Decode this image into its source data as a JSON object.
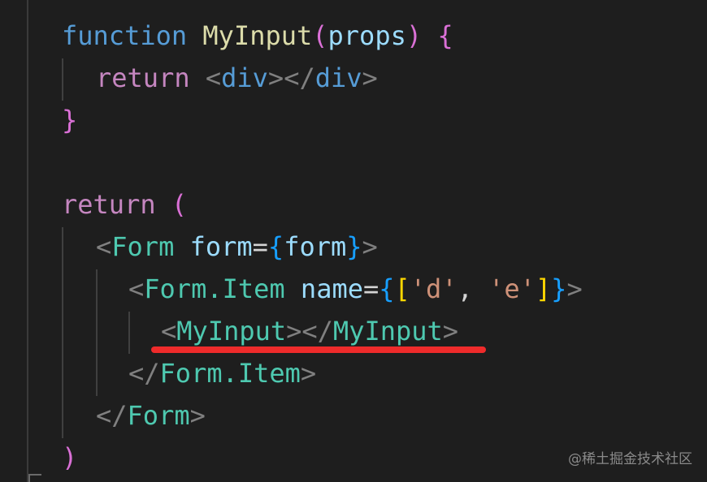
{
  "code": {
    "l1": {
      "kw": "function",
      "name": "MyInput",
      "open_paren": "(",
      "param": "props",
      "close_paren": ")",
      "brace": "{"
    },
    "l2": {
      "kw": "return",
      "lt1": "<",
      "tag1": "div",
      "mid": "></",
      "tag2": "div",
      "gt": ">"
    },
    "l3": {
      "brace": "}"
    },
    "l5": {
      "kw": "return",
      "paren": "("
    },
    "l6": {
      "lt": "<",
      "tag": "Form",
      "attr": "form",
      "eq": "=",
      "ob": "{",
      "val": "form",
      "cb": "}",
      "gt": ">"
    },
    "l7": {
      "lt": "<",
      "tag": "Form.Item",
      "attr": "name",
      "eq": "=",
      "ob": "{",
      "osq": "[",
      "s1": "'d'",
      "comma": ",",
      "s2": "'e'",
      "csq": "]",
      "cb": "}",
      "gt": ">"
    },
    "l8": {
      "lt1": "<",
      "tag1": "MyInput",
      "mid": "></",
      "tag2": "MyInput",
      "gt": ">"
    },
    "l9": {
      "lt": "</",
      "tag": "Form.Item",
      "gt": ">"
    },
    "l10": {
      "lt": "</",
      "tag": "Form",
      "gt": ">"
    },
    "l11": {
      "paren": ")"
    }
  },
  "watermark": "@稀土掘金技术社区",
  "colors": {
    "background": "#1e1e1e",
    "highlight_underline": "#ef2b2b"
  }
}
